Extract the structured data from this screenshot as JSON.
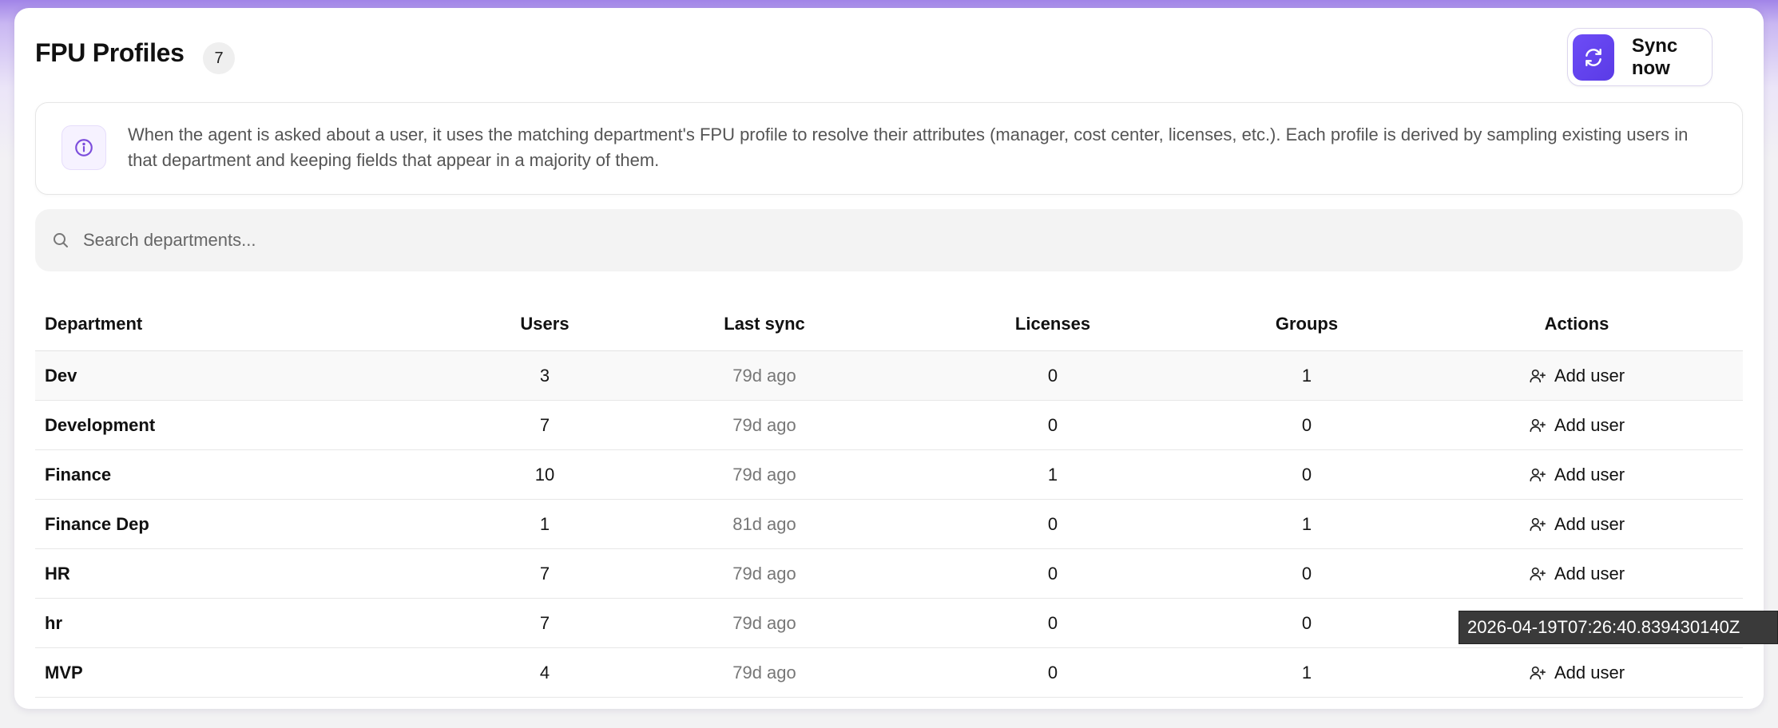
{
  "header": {
    "title": "FPU Profiles",
    "count": "7",
    "sync_label": "Sync now"
  },
  "info": {
    "text": "When the agent is asked about a user, it uses the matching department's FPU profile to resolve their attributes (manager, cost center, licenses, etc.). Each profile is derived by sampling existing users in that department and keeping fields that appear in a majority of them."
  },
  "search": {
    "placeholder": "Search departments..."
  },
  "table": {
    "columns": [
      "Department",
      "Users",
      "Last sync",
      "Licenses",
      "Groups",
      "Actions"
    ],
    "action_label": "Add user",
    "rows": [
      {
        "department": "Dev",
        "users": "3",
        "last_sync": "79d ago",
        "licenses": "0",
        "groups": "1"
      },
      {
        "department": "Development",
        "users": "7",
        "last_sync": "79d ago",
        "licenses": "0",
        "groups": "0"
      },
      {
        "department": "Finance",
        "users": "10",
        "last_sync": "79d ago",
        "licenses": "1",
        "groups": "0"
      },
      {
        "department": "Finance Dep",
        "users": "1",
        "last_sync": "81d ago",
        "licenses": "0",
        "groups": "1"
      },
      {
        "department": "HR",
        "users": "7",
        "last_sync": "79d ago",
        "licenses": "0",
        "groups": "0"
      },
      {
        "department": "hr",
        "users": "7",
        "last_sync": "79d ago",
        "licenses": "0",
        "groups": "0"
      },
      {
        "department": "MVP",
        "users": "4",
        "last_sync": "79d ago",
        "licenses": "0",
        "groups": "1"
      }
    ]
  },
  "tooltip": {
    "text": "2026-04-19T07:26:40.839430140Z"
  },
  "colors": {
    "accent": "#6d4cf6",
    "info_icon": "#7c4ddc"
  },
  "icons": {
    "sync": "refresh-icon",
    "info": "info-icon",
    "search": "search-icon",
    "add_user": "user-plus-icon"
  }
}
